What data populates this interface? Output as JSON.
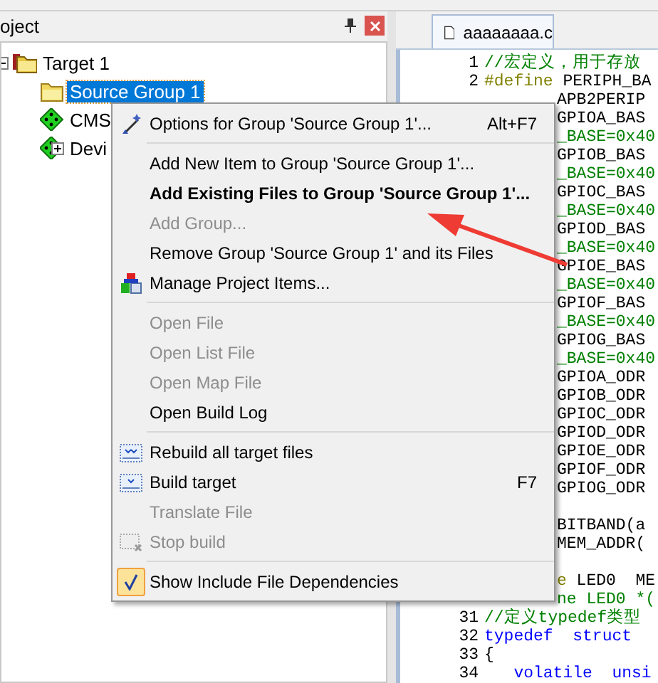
{
  "project_panel": {
    "title": "oject",
    "tree": [
      {
        "label": "Target 1",
        "kind": "target",
        "selected": false,
        "expanded": true,
        "children": [
          {
            "label": "Source Group 1",
            "kind": "group",
            "selected": true
          },
          {
            "label": "CMS",
            "kind": "component",
            "selected": false
          },
          {
            "label": "Devi",
            "kind": "component",
            "selected": false,
            "expanded": false
          }
        ]
      }
    ]
  },
  "editor": {
    "tabs": [
      {
        "label": "aaaaaaaa.c",
        "selected": true
      }
    ],
    "lines": [
      {
        "kind": "code",
        "number": "1",
        "covered": false,
        "segments": [
          {
            "text": "//宏定义，用于存放",
            "kind": "comment"
          }
        ]
      },
      {
        "kind": "code",
        "number": "2",
        "covered": false,
        "segments": [
          {
            "text": "#define",
            "kind": "preprocessor"
          },
          {
            "text": " PERIPH_BA",
            "kind": "plain"
          }
        ]
      },
      {
        "kind": "code",
        "covered": true,
        "segments": [
          {
            "text": "APB2PERIP",
            "kind": "plain"
          }
        ]
      },
      {
        "kind": "code",
        "covered": true,
        "segments": [
          {
            "text": "GPIOA_BAS",
            "kind": "plain"
          }
        ]
      },
      {
        "kind": "code",
        "covered": true,
        "segments": [
          {
            "text": "_BASE=0x40",
            "kind": "comment"
          }
        ]
      },
      {
        "kind": "code",
        "covered": true,
        "segments": [
          {
            "text": "GPIOB_BAS",
            "kind": "plain"
          }
        ]
      },
      {
        "kind": "code",
        "covered": true,
        "segments": [
          {
            "text": "_BASE=0x40",
            "kind": "comment"
          }
        ]
      },
      {
        "kind": "code",
        "covered": true,
        "segments": [
          {
            "text": "GPIOC_BAS",
            "kind": "plain"
          }
        ]
      },
      {
        "kind": "code",
        "covered": true,
        "segments": [
          {
            "text": "_BASE=0x40",
            "kind": "comment"
          }
        ]
      },
      {
        "kind": "code",
        "covered": true,
        "segments": [
          {
            "text": "GPIOD_BAS",
            "kind": "plain"
          }
        ]
      },
      {
        "kind": "code",
        "covered": true,
        "segments": [
          {
            "text": "_BASE=0x40",
            "kind": "comment"
          }
        ]
      },
      {
        "kind": "code",
        "covered": true,
        "segments": [
          {
            "text": "GPIOE_BAS",
            "kind": "plain"
          }
        ]
      },
      {
        "kind": "code",
        "covered": true,
        "segments": [
          {
            "text": "_BASE=0x40",
            "kind": "comment"
          }
        ]
      },
      {
        "kind": "code",
        "covered": true,
        "segments": [
          {
            "text": "GPIOF_BAS",
            "kind": "plain"
          }
        ]
      },
      {
        "kind": "code",
        "covered": true,
        "segments": [
          {
            "text": "_BASE=0x40",
            "kind": "comment"
          }
        ]
      },
      {
        "kind": "code",
        "covered": true,
        "segments": [
          {
            "text": "GPIOG_BAS",
            "kind": "plain"
          }
        ]
      },
      {
        "kind": "code",
        "covered": true,
        "segments": [
          {
            "text": "_BASE=0x40",
            "kind": "comment"
          }
        ]
      },
      {
        "kind": "code",
        "covered": true,
        "segments": [
          {
            "text": "GPIOA_ODR",
            "kind": "plain"
          }
        ]
      },
      {
        "kind": "code",
        "covered": true,
        "segments": [
          {
            "text": "GPIOB_ODR",
            "kind": "plain"
          }
        ]
      },
      {
        "kind": "code",
        "covered": true,
        "segments": [
          {
            "text": "GPIOC_ODR",
            "kind": "plain"
          }
        ]
      },
      {
        "kind": "code",
        "covered": true,
        "segments": [
          {
            "text": "GPIOD_ODR",
            "kind": "plain"
          }
        ]
      },
      {
        "kind": "code",
        "covered": true,
        "segments": [
          {
            "text": "GPIOE_ODR",
            "kind": "plain"
          }
        ]
      },
      {
        "kind": "code",
        "covered": true,
        "segments": [
          {
            "text": "GPIOF_ODR",
            "kind": "plain"
          }
        ]
      },
      {
        "kind": "code",
        "covered": true,
        "segments": [
          {
            "text": "GPIOG_ODR",
            "kind": "plain"
          }
        ]
      },
      {
        "kind": "blank"
      },
      {
        "kind": "code",
        "covered": true,
        "segments": [
          {
            "text": "BITBAND(a",
            "kind": "plain"
          }
        ]
      },
      {
        "kind": "code",
        "covered": true,
        "segments": [
          {
            "text": "MEM_ADDR(",
            "kind": "plain"
          }
        ]
      },
      {
        "kind": "blank"
      },
      {
        "kind": "code",
        "covered": true,
        "segments": [
          {
            "text": "e",
            "kind": "preprocessor"
          },
          {
            "text": " LED0  ME",
            "kind": "plain"
          }
        ]
      },
      {
        "kind": "code",
        "covered": true,
        "segments": [
          {
            "text": "ne LED0 *(",
            "kind": "comment"
          }
        ]
      },
      {
        "kind": "code",
        "number": "31",
        "covered": false,
        "segments": [
          {
            "text": "//定义typedef类型",
            "kind": "comment"
          }
        ]
      },
      {
        "kind": "code",
        "number": "32",
        "covered": false,
        "segments": [
          {
            "text": "typedef  struct",
            "kind": "keyword"
          }
        ]
      },
      {
        "kind": "code",
        "number": "33",
        "covered": false,
        "segments": [
          {
            "text": "{",
            "kind": "plain"
          }
        ]
      },
      {
        "kind": "code",
        "number": "34",
        "covered": false,
        "segments": [
          {
            "text": "   volatile  unsi",
            "kind": "keyword"
          }
        ]
      }
    ]
  },
  "context_menu": {
    "items": [
      {
        "kind": "options",
        "label": "Options for Group 'Source Group 1'...",
        "shortcut": "Alt+F7",
        "disabled": false,
        "bold": false
      },
      {
        "kind": "separator"
      },
      {
        "kind": "plain",
        "label": "Add New  Item to Group 'Source Group 1'...",
        "disabled": false,
        "bold": false
      },
      {
        "kind": "plain",
        "label": "Add Existing Files to Group 'Source Group 1'...",
        "disabled": false,
        "bold": true
      },
      {
        "kind": "plain",
        "label": "Add Group...",
        "disabled": true,
        "bold": false
      },
      {
        "kind": "plain",
        "label": "Remove Group 'Source Group 1' and its Files",
        "disabled": false,
        "bold": false
      },
      {
        "kind": "manage",
        "label": "Manage Project Items...",
        "disabled": false,
        "bold": false
      },
      {
        "kind": "separator"
      },
      {
        "kind": "plain",
        "label": "Open File",
        "disabled": true,
        "bold": false
      },
      {
        "kind": "plain",
        "label": "Open List File",
        "disabled": true,
        "bold": false
      },
      {
        "kind": "plain",
        "label": "Open Map File",
        "disabled": true,
        "bold": false
      },
      {
        "kind": "plain",
        "label": "Open Build Log",
        "disabled": false,
        "bold": false
      },
      {
        "kind": "separator"
      },
      {
        "kind": "rebuild",
        "label": "Rebuild all target files",
        "disabled": false,
        "bold": false
      },
      {
        "kind": "build",
        "label": "Build target",
        "shortcut": "F7",
        "disabled": false,
        "bold": false
      },
      {
        "kind": "plain",
        "label": "Translate File",
        "disabled": true,
        "bold": false
      },
      {
        "kind": "stop",
        "label": "Stop build",
        "disabled": true,
        "bold": false
      },
      {
        "kind": "separator"
      },
      {
        "kind": "check",
        "label": "Show Include File Dependencies",
        "checked": true,
        "disabled": false,
        "bold": false
      }
    ]
  }
}
